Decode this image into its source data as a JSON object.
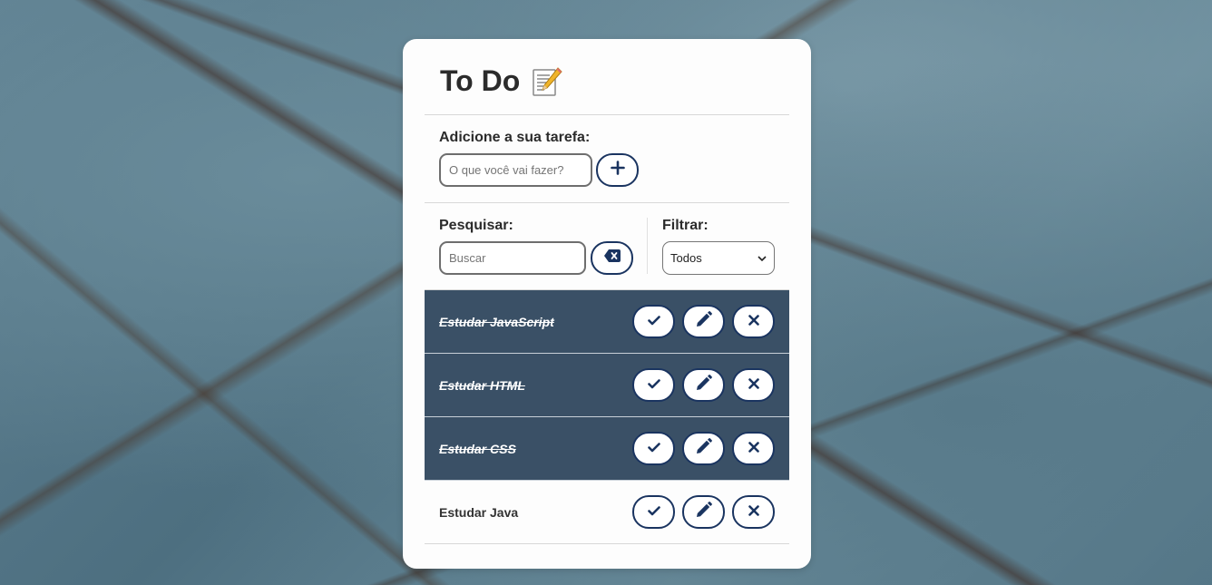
{
  "header": {
    "title": "To Do",
    "emoji": "📝"
  },
  "add": {
    "label": "Adicione a sua tarefa:",
    "placeholder": "O que você vai fazer?",
    "value": ""
  },
  "search": {
    "label": "Pesquisar:",
    "placeholder": "Buscar",
    "value": ""
  },
  "filter": {
    "label": "Filtrar:",
    "selected": "Todos"
  },
  "todos": [
    {
      "text": "Estudar JavaScript",
      "done": true
    },
    {
      "text": "Estudar HTML",
      "done": true
    },
    {
      "text": "Estudar CSS",
      "done": true
    },
    {
      "text": "Estudar Java",
      "done": false
    }
  ],
  "colors": {
    "accent": "#1a3460",
    "done_bg": "#3a5066",
    "card_bg": "#fdfdfd"
  },
  "icons": {
    "add": "plus-icon",
    "clear_search": "backspace-icon",
    "finish": "check-icon",
    "edit": "pencil-icon",
    "remove": "x-icon"
  }
}
